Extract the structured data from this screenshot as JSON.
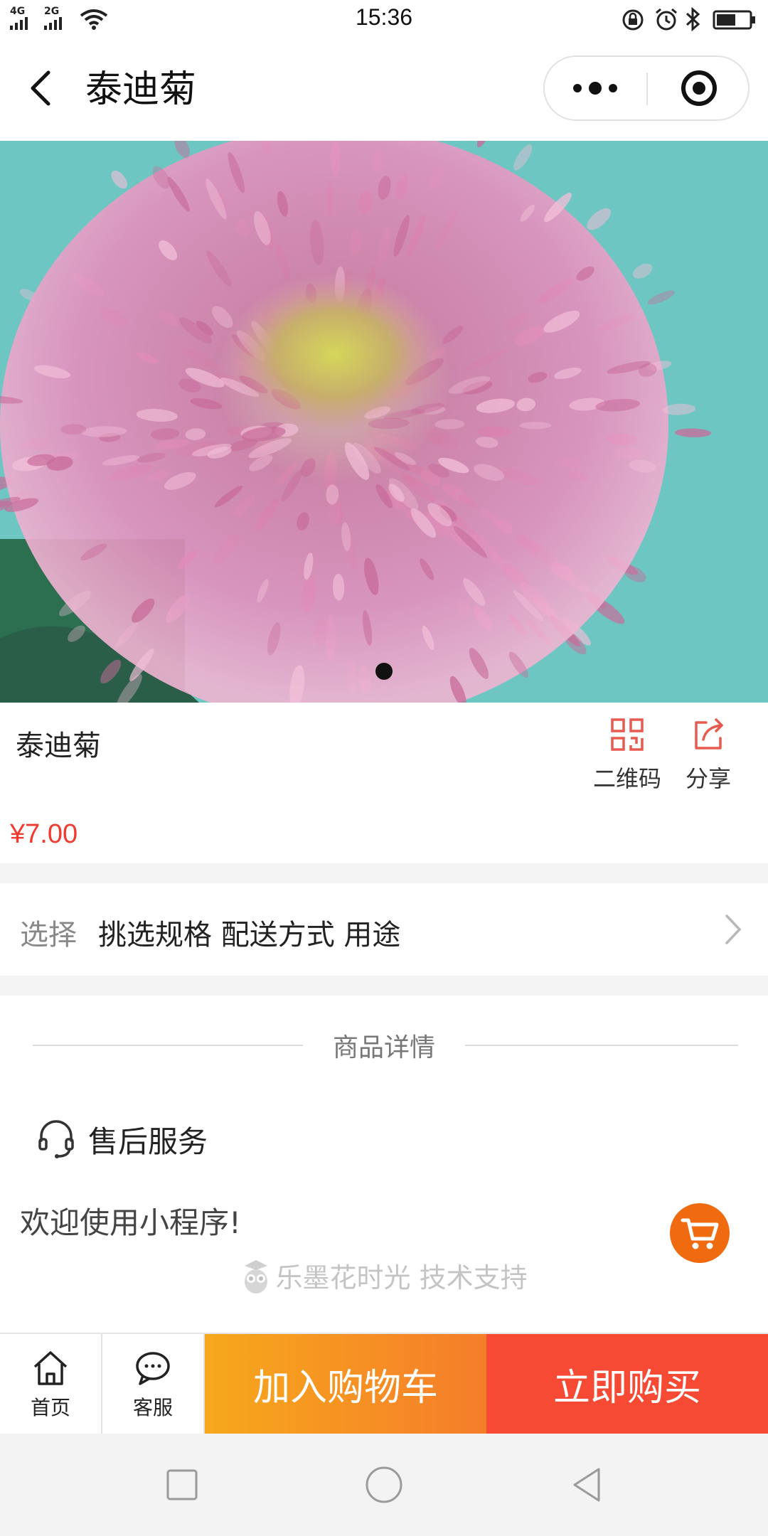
{
  "status_bar": {
    "network_1": "4G",
    "network_2": "2G",
    "time": "15:36",
    "battery_level": 0.6
  },
  "nav": {
    "title": "泰迪菊",
    "more_icon": "more-dots-icon",
    "close_icon": "target-close-icon"
  },
  "carousel": {
    "image": "pink-teddy-chrysanthemum-photo",
    "slide_count": 1,
    "active_slide": 1
  },
  "product": {
    "name": "泰迪菊",
    "price": "¥7.00",
    "qrcode_label": "二维码",
    "share_label": "分享"
  },
  "select_row": {
    "label": "选择",
    "options": "挑选规格 配送方式 用途"
  },
  "details": {
    "section_title": "商品详情",
    "service_label": "售后服务",
    "welcome_text": "欢迎使用小程序!",
    "support_text": "乐墨花时光 技术支持"
  },
  "bottom_bar": {
    "home_label": "首页",
    "service_label": "客服",
    "add_cart_label": "加入购物车",
    "buy_now_label": "立即购买"
  },
  "colors": {
    "price": "#f23a30",
    "add_cart_start": "#f6a81c",
    "add_cart_end": "#f57d2a",
    "buy_now": "#f64a34",
    "cart_fab": "#f06a10",
    "icon_red": "#e85a4f"
  }
}
